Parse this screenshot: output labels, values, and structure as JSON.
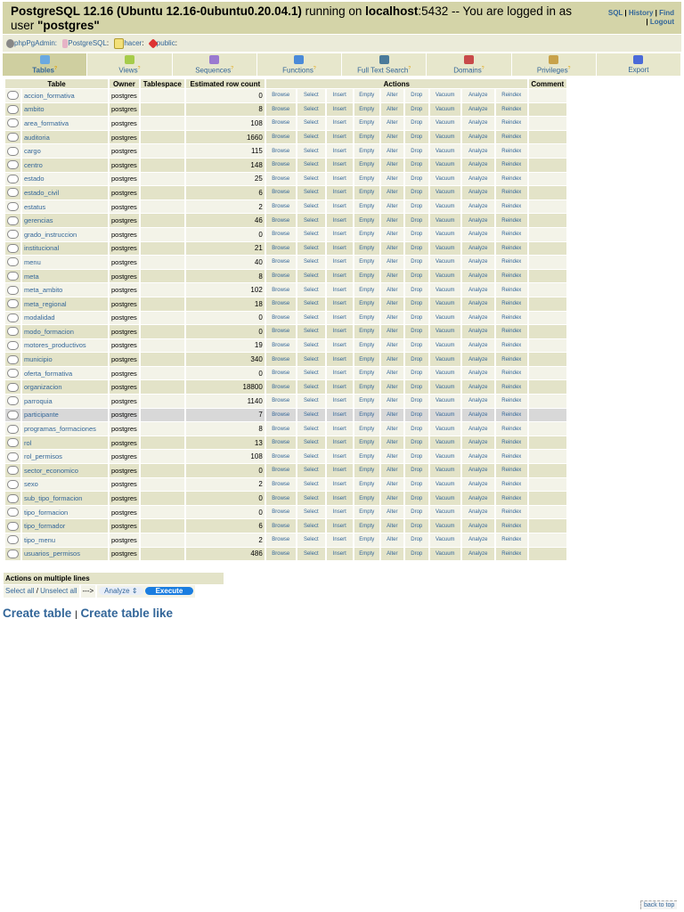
{
  "header": {
    "server": "PostgreSQL 12.16 (Ubuntu 12.16-0ubuntu0.20.04.1)",
    "running_on": " running on ",
    "host": "localhost",
    "port_msg": ":5432 -- You are logged in as user ",
    "user": "\"postgres\"",
    "links": {
      "sql": "SQL",
      "history": "History",
      "find": "Find",
      "logout": "Logout"
    }
  },
  "breadcrumb": [
    "phpPgAdmin:",
    "PostgreSQL",
    "hacer",
    "public"
  ],
  "tabs": [
    "Tables",
    "Views",
    "Sequences",
    "Functions",
    "Full Text Search",
    "Domains",
    "Privileges",
    "Export"
  ],
  "columns": [
    "Table",
    "Owner",
    "Tablespace",
    "Estimated row count",
    "Actions",
    "Comment"
  ],
  "actions": [
    "Browse",
    "Select",
    "Insert",
    "Empty",
    "Alter",
    "Drop",
    "Vacuum",
    "Analyze",
    "Reindex"
  ],
  "rows": [
    {
      "name": "accion_formativa",
      "owner": "postgres",
      "count": "0"
    },
    {
      "name": "ambito",
      "owner": "postgres",
      "count": "8"
    },
    {
      "name": "area_formativa",
      "owner": "postgres",
      "count": "108"
    },
    {
      "name": "auditoria",
      "owner": "postgres",
      "count": "1660"
    },
    {
      "name": "cargo",
      "owner": "postgres",
      "count": "115"
    },
    {
      "name": "centro",
      "owner": "postgres",
      "count": "148"
    },
    {
      "name": "estado",
      "owner": "postgres",
      "count": "25"
    },
    {
      "name": "estado_civil",
      "owner": "postgres",
      "count": "6"
    },
    {
      "name": "estatus",
      "owner": "postgres",
      "count": "2"
    },
    {
      "name": "gerencias",
      "owner": "postgres",
      "count": "46"
    },
    {
      "name": "grado_instruccion",
      "owner": "postgres",
      "count": "0"
    },
    {
      "name": "institucional",
      "owner": "postgres",
      "count": "21"
    },
    {
      "name": "menu",
      "owner": "postgres",
      "count": "40"
    },
    {
      "name": "meta",
      "owner": "postgres",
      "count": "8"
    },
    {
      "name": "meta_ambito",
      "owner": "postgres",
      "count": "102"
    },
    {
      "name": "meta_regional",
      "owner": "postgres",
      "count": "18"
    },
    {
      "name": "modalidad",
      "owner": "postgres",
      "count": "0"
    },
    {
      "name": "modo_formacion",
      "owner": "postgres",
      "count": "0"
    },
    {
      "name": "motores_productivos",
      "owner": "postgres",
      "count": "19"
    },
    {
      "name": "municipio",
      "owner": "postgres",
      "count": "340"
    },
    {
      "name": "oferta_formativa",
      "owner": "postgres",
      "count": "0"
    },
    {
      "name": "organizacion",
      "owner": "postgres",
      "count": "18800"
    },
    {
      "name": "parroquia",
      "owner": "postgres",
      "count": "1140"
    },
    {
      "name": "participante",
      "owner": "postgres",
      "count": "7"
    },
    {
      "name": "programas_formaciones",
      "owner": "postgres",
      "count": "8"
    },
    {
      "name": "rol",
      "owner": "postgres",
      "count": "13"
    },
    {
      "name": "rol_permisos",
      "owner": "postgres",
      "count": "108"
    },
    {
      "name": "sector_economico",
      "owner": "postgres",
      "count": "0"
    },
    {
      "name": "sexo",
      "owner": "postgres",
      "count": "2"
    },
    {
      "name": "sub_tipo_formacion",
      "owner": "postgres",
      "count": "0"
    },
    {
      "name": "tipo_formacion",
      "owner": "postgres",
      "count": "0"
    },
    {
      "name": "tipo_formador",
      "owner": "postgres",
      "count": "6"
    },
    {
      "name": "tipo_menu",
      "owner": "postgres",
      "count": "2"
    },
    {
      "name": "usuarios_permisos",
      "owner": "postgres",
      "count": "486"
    }
  ],
  "highlighted_row": "participante",
  "multi": {
    "title": "Actions on multiple lines",
    "select_all": "Select all",
    "slash": " / ",
    "unselect_all": "Unselect all",
    "arrow": "--->",
    "action": "Analyze",
    "execute": "Execute"
  },
  "create": {
    "create_table": "Create table",
    "sep": "|",
    "create_like": "Create table like"
  },
  "back_to_top": "back to top"
}
